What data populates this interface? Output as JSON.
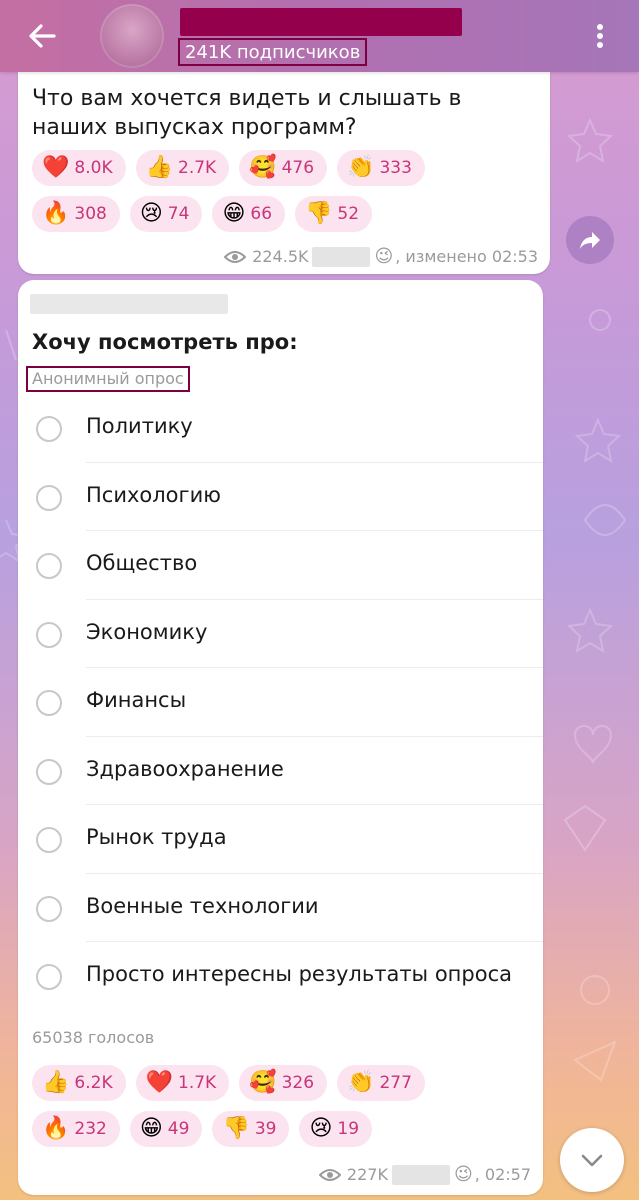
{
  "header": {
    "subscribers": "241K подписчиков"
  },
  "post1": {
    "question": "Что вам хочется видеть и слышать в наших выпусках программ?",
    "reactions": [
      {
        "emoji": "❤️",
        "icon": "heart-icon",
        "count": "8.0K"
      },
      {
        "emoji": "👍",
        "icon": "thumbs-up-icon",
        "count": "2.7K"
      },
      {
        "emoji": "🥰",
        "icon": "smiling-face-with-hearts-icon",
        "count": "476"
      },
      {
        "emoji": "👏",
        "icon": "clapping-hands-icon",
        "count": "333"
      },
      {
        "emoji": "🔥",
        "icon": "fire-icon",
        "count": "308"
      },
      {
        "emoji": "😢",
        "icon": "crying-face-icon",
        "count": "74"
      },
      {
        "emoji": "😁",
        "icon": "grinning-face-icon",
        "count": "66"
      },
      {
        "emoji": "👎",
        "icon": "thumbs-down-icon",
        "count": "52"
      }
    ],
    "views": "224.5K",
    "edited": ", изменено 02:53"
  },
  "post2": {
    "poll_title": "Хочу посмотреть про:",
    "poll_type": "Анонимный опрос",
    "options": [
      "Политику",
      "Психологию",
      "Общество",
      "Экономику",
      "Финансы",
      "Здравоохранение",
      "Рынок труда",
      "Военные технологии",
      "Просто интересны результаты опроса"
    ],
    "votes": "65038 голосов",
    "reactions": [
      {
        "emoji": "👍",
        "icon": "thumbs-up-icon",
        "count": "6.2K"
      },
      {
        "emoji": "❤️",
        "icon": "heart-icon",
        "count": "1.7K"
      },
      {
        "emoji": "🥰",
        "icon": "smiling-face-with-hearts-icon",
        "count": "326"
      },
      {
        "emoji": "👏",
        "icon": "clapping-hands-icon",
        "count": "277"
      },
      {
        "emoji": "🔥",
        "icon": "fire-icon",
        "count": "232"
      },
      {
        "emoji": "😁",
        "icon": "grinning-face-icon",
        "count": "49"
      },
      {
        "emoji": "👎",
        "icon": "thumbs-down-icon",
        "count": "39"
      },
      {
        "emoji": "😢",
        "icon": "crying-face-icon",
        "count": "19"
      }
    ],
    "views": "227K",
    "time": ", 02:57"
  },
  "colors": {
    "header_accent": "#b070b0",
    "redaction": "#95004d",
    "reaction_bg": "#fbe3ef",
    "reaction_text": "#c8357a"
  }
}
